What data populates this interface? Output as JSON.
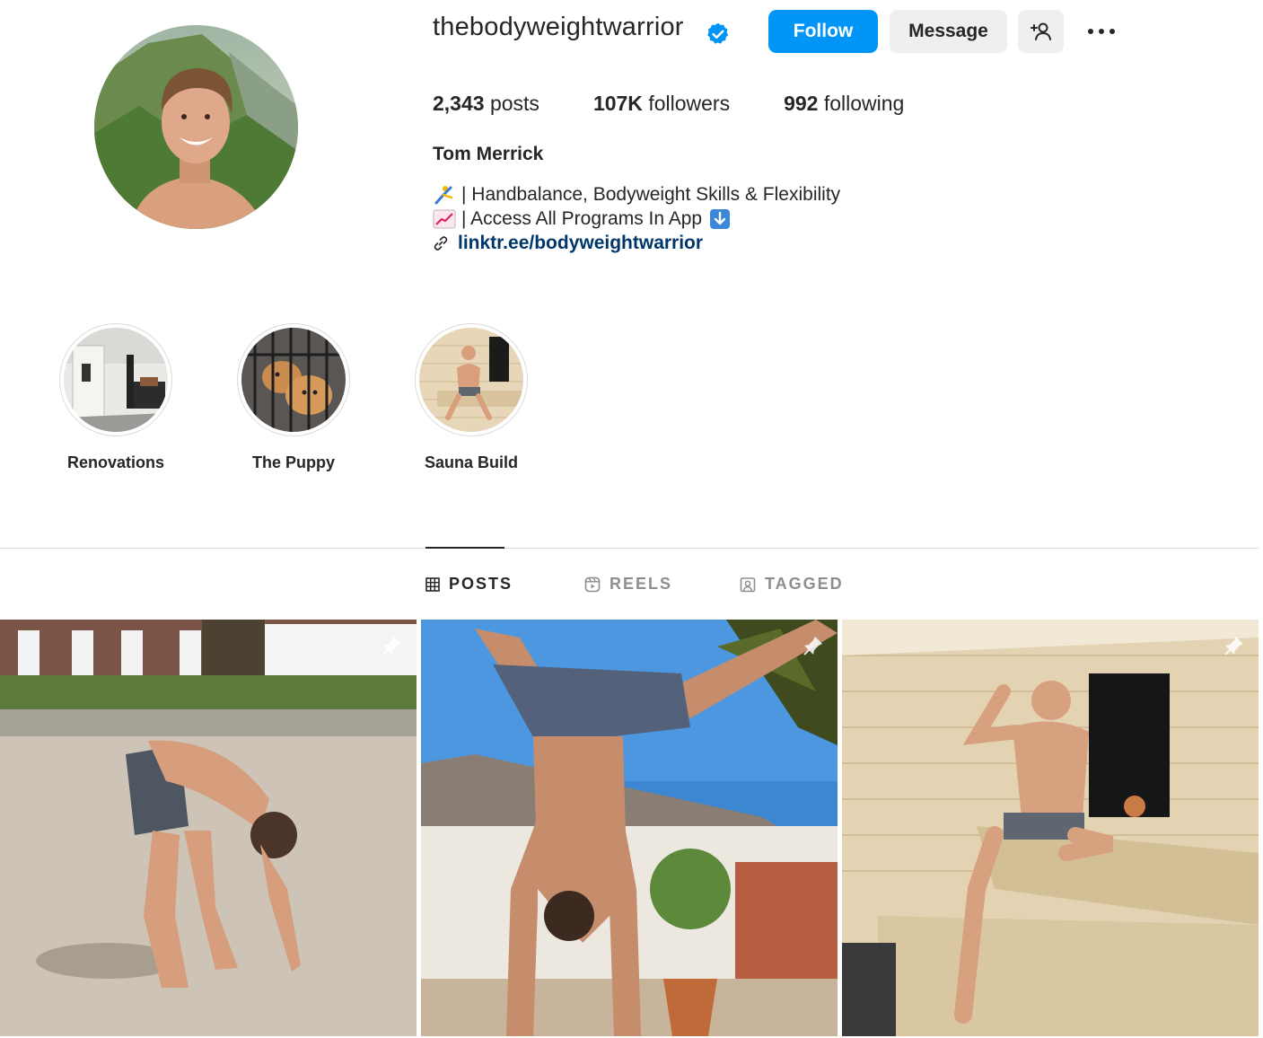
{
  "profile": {
    "username": "thebodyweightwarrior",
    "verified": true,
    "full_name": "Tom Merrick",
    "bio_lines": [
      "| Handbalance, Bodyweight Skills & Flexibility",
      "| Access All Programs In App"
    ],
    "link": "linktr.ee/bodyweightwarrior"
  },
  "buttons": {
    "follow": "Follow",
    "message": "Message"
  },
  "stats": {
    "posts_count": "2,343",
    "posts_label": "posts",
    "followers_count": "107K",
    "followers_label": "followers",
    "following_count": "992",
    "following_label": "following"
  },
  "highlights": [
    {
      "label": "Renovations"
    },
    {
      "label": "The Puppy"
    },
    {
      "label": "Sauna Build"
    }
  ],
  "tabs": {
    "posts": "POSTS",
    "reels": "REELS",
    "tagged": "TAGGED",
    "active": "posts"
  },
  "icons": {
    "verified": "verified-badge-icon",
    "suggest": "add-person-icon",
    "more": "more-options-icon",
    "link": "link-icon",
    "posts_tab": "grid-icon",
    "reels_tab": "reels-icon",
    "tagged_tab": "tagged-icon",
    "pinned": "pin-icon"
  },
  "colors": {
    "accent": "#0095f6",
    "link": "#00376b",
    "secondary_button": "#efefef",
    "muted_text": "#8e8e8e"
  },
  "posts": [
    {
      "pinned": true
    },
    {
      "pinned": true
    },
    {
      "pinned": true
    }
  ]
}
